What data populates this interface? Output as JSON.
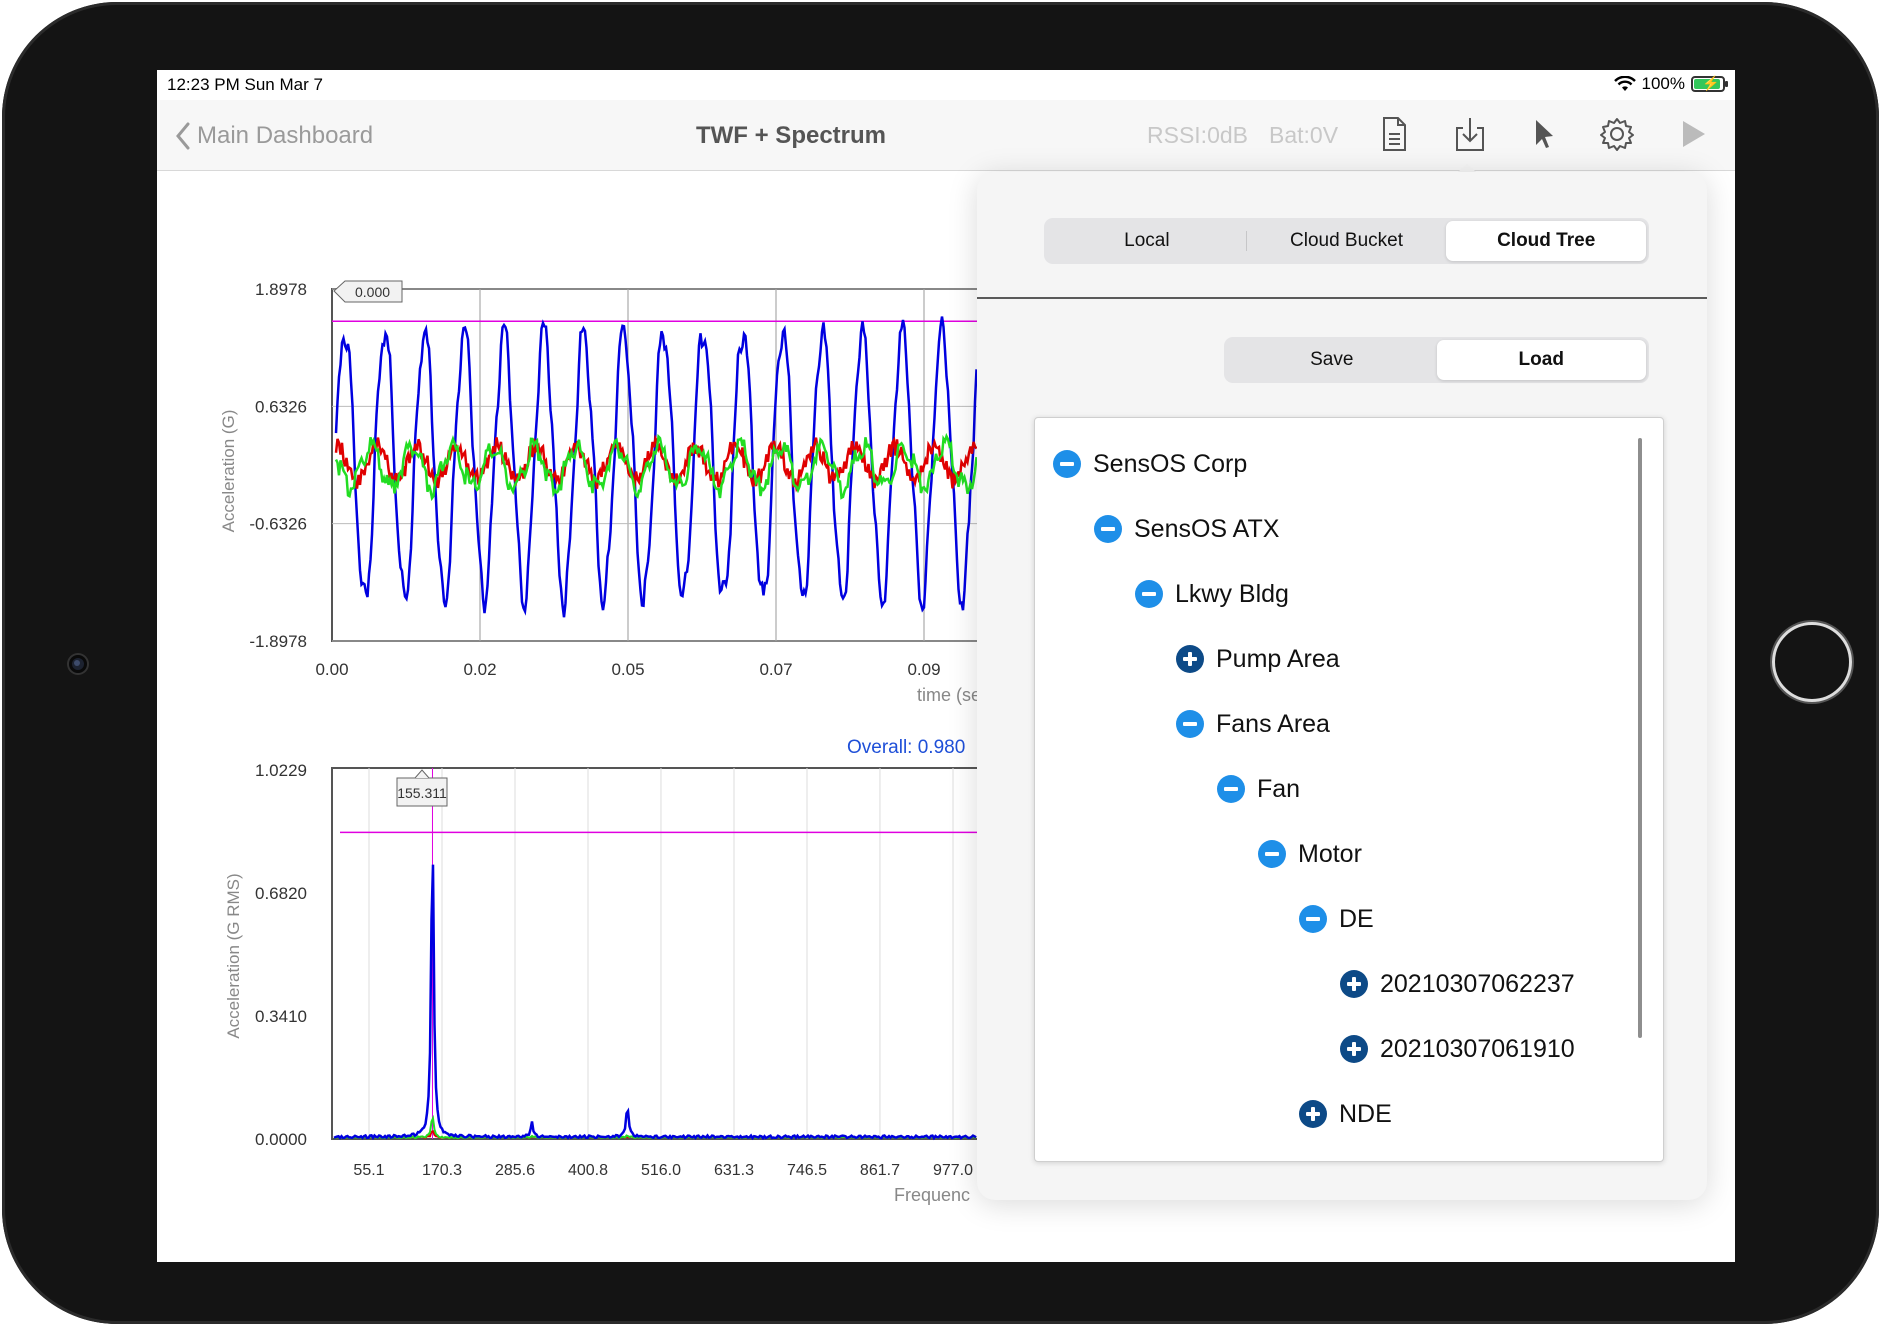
{
  "status_bar": {
    "time": "12:23 PM  Sun Mar 7",
    "battery": "100%"
  },
  "nav": {
    "back_label": "Main Dashboard",
    "title": "TWF + Spectrum",
    "rssi": "RSSI:0dB",
    "bat": "Bat:0V",
    "icons": [
      "document-icon",
      "download-icon",
      "pointer-icon",
      "gear-icon",
      "play-icon"
    ]
  },
  "colors": {
    "accent": "#1e8fe8",
    "plus_node": "#0d4a87",
    "series_x": "#0000e0",
    "series_y": "#e00000",
    "series_z": "#22dd22",
    "marker": "#e000e0"
  },
  "chart_data": [
    {
      "type": "line",
      "ylabel": "Acceleration (G)",
      "xlabel": "time (se",
      "y_ticks": [
        "1.8978",
        "0.6326",
        "-0.6326",
        "-1.8978"
      ],
      "x_ticks": [
        "0.00",
        "0.02",
        "0.05",
        "0.07",
        "0.09"
      ],
      "ylim": [
        -1.8978,
        1.8978
      ],
      "cursor_label": "0.000",
      "marker_level": 1.55,
      "grid": true,
      "series": [
        {
          "color": "#0000e0",
          "amplitude": 1.45,
          "cycles_visible": 16
        },
        {
          "color": "#e00000",
          "amplitude": 0.18
        },
        {
          "color": "#22dd22",
          "amplitude": 0.22
        }
      ]
    },
    {
      "type": "line",
      "ylabel": "Acceleration (G RMS)",
      "xlabel": "Frequenc",
      "overall_label": "Overall: 0.980",
      "y_ticks": [
        "1.0229",
        "0.6820",
        "0.3410",
        "0.0000"
      ],
      "x_ticks": [
        "55.1",
        "170.3",
        "285.6",
        "400.8",
        "516.0",
        "631.3",
        "746.5",
        "861.7",
        "977.0"
      ],
      "ylim": [
        0,
        1.0229
      ],
      "cursor_label": "155.311",
      "peak_frequency": 155.311,
      "peak_value": 0.84,
      "marker_level": 0.85,
      "grid": true
    }
  ],
  "popover": {
    "source_tabs": [
      {
        "label": "Local",
        "selected": false
      },
      {
        "label": "Cloud Bucket",
        "selected": false
      },
      {
        "label": "Cloud Tree",
        "selected": true
      }
    ],
    "action_tabs": [
      {
        "label": "Save",
        "selected": false
      },
      {
        "label": "Load",
        "selected": true
      }
    ],
    "tree": [
      {
        "label": "SensOS Corp",
        "level": 0,
        "expanded": true
      },
      {
        "label": "SensOS ATX",
        "level": 1,
        "expanded": true
      },
      {
        "label": "Lkwy Bldg",
        "level": 2,
        "expanded": true
      },
      {
        "label": "Pump Area",
        "level": 3,
        "expanded": false
      },
      {
        "label": "Fans Area",
        "level": 3,
        "expanded": true
      },
      {
        "label": "Fan",
        "level": 4,
        "expanded": true
      },
      {
        "label": "Motor",
        "level": 5,
        "expanded": true
      },
      {
        "label": "DE",
        "level": 6,
        "expanded": true
      },
      {
        "label": "20210307062237",
        "level": 7,
        "expanded": false
      },
      {
        "label": "20210307061910",
        "level": 7,
        "expanded": false
      },
      {
        "label": "NDE",
        "level": 6,
        "expanded": false
      }
    ]
  }
}
